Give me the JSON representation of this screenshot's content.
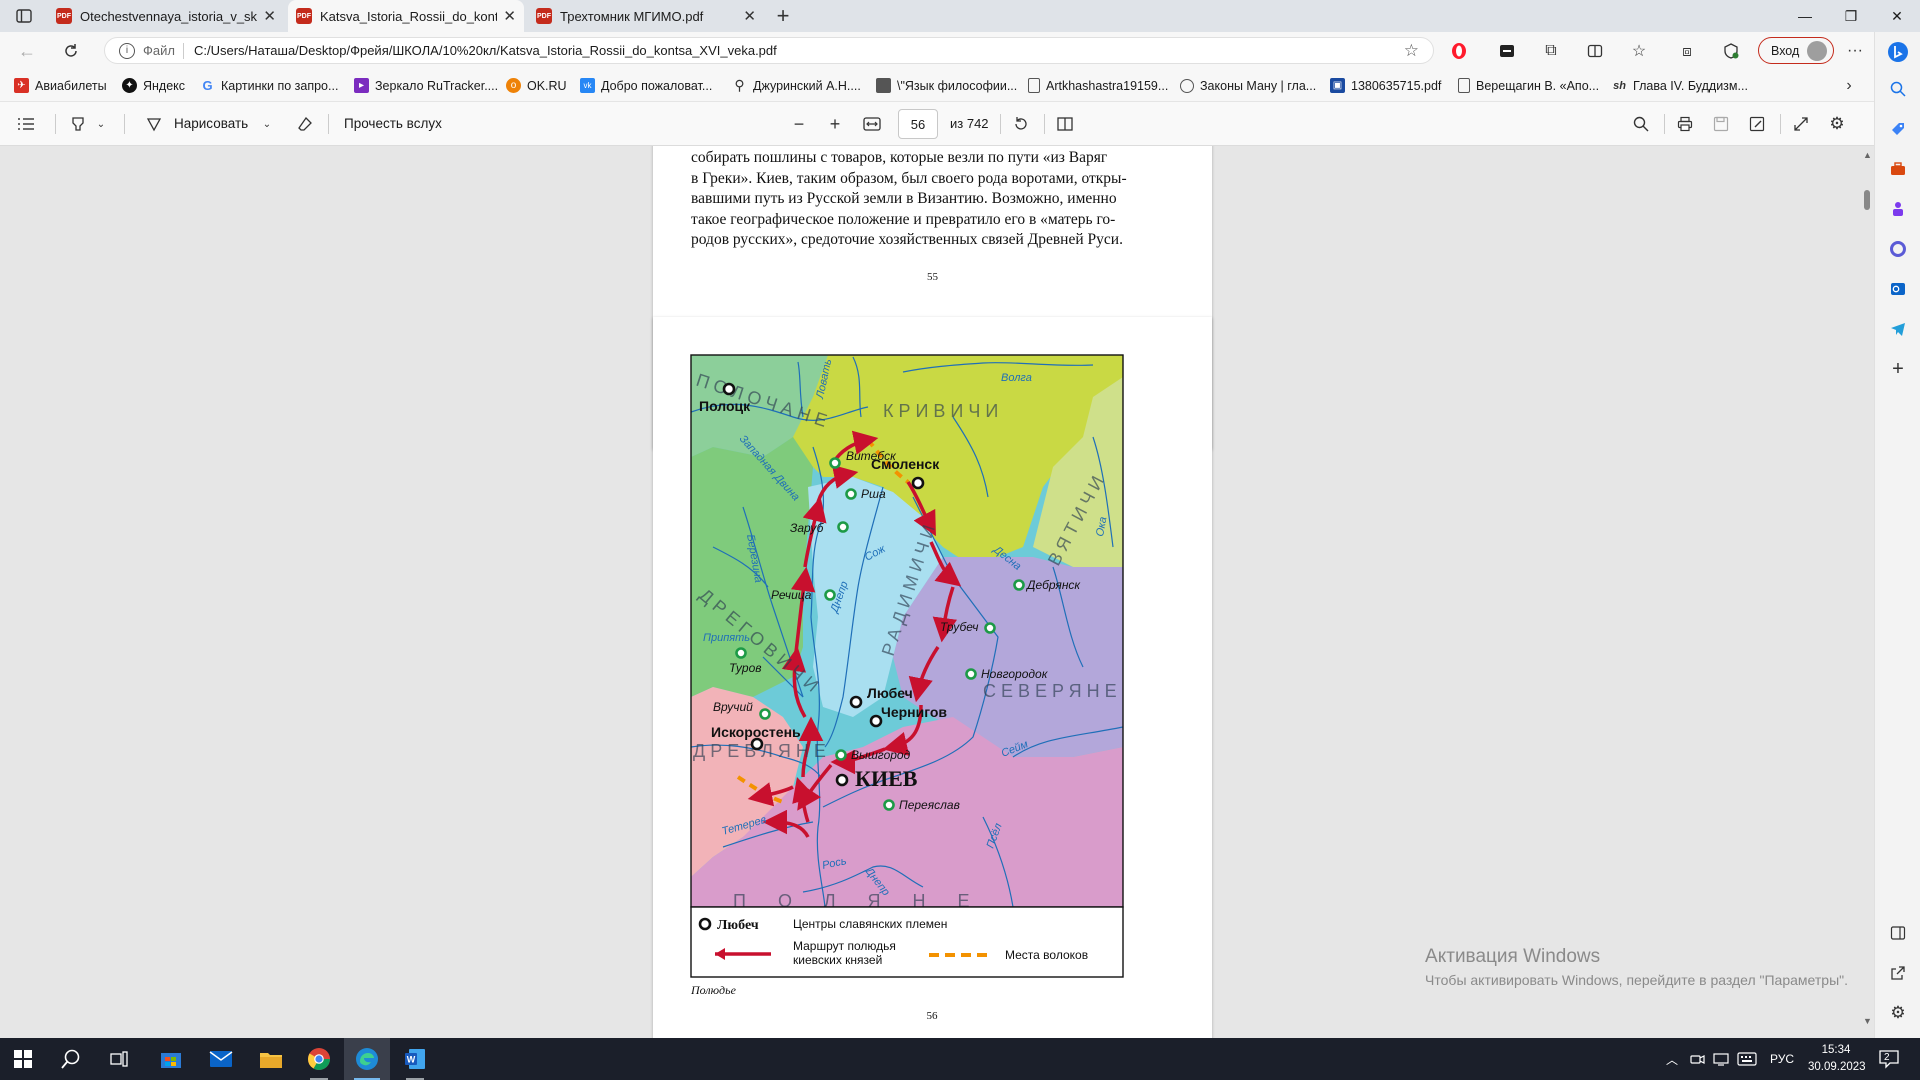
{
  "tabs": [
    {
      "title": "Otechestvennaya_istoria_v_skhem",
      "active": false
    },
    {
      "title": "Katsva_Istoria_Rossii_do_kontsa_",
      "active": true
    },
    {
      "title": "Трехтомник МГИМО.pdf",
      "active": false
    }
  ],
  "address": {
    "prefix": "Файл",
    "url": "C:/Users/Наташа/Desktop/Фрейя/ШКОЛА/10%20кл/Katsva_Istoria_Rossii_do_kontsa_XVI_veka.pdf"
  },
  "profile_button": "Вход",
  "bookmarks": [
    {
      "label": "Авиабилеты",
      "icon": "airplane-icon",
      "color": "#d93025"
    },
    {
      "label": "Яндекс",
      "icon": "yandex-icon",
      "color": "#111111"
    },
    {
      "label": "Картинки по запро...",
      "icon": "google-icon",
      "color": "#4285f4"
    },
    {
      "label": "Зеркало RuTracker....",
      "icon": "rutracker-icon",
      "color": "#7b2cbf"
    },
    {
      "label": "OK.RU",
      "icon": "ok-icon",
      "color": "#ee8208"
    },
    {
      "label": "Добро пожаловат...",
      "icon": "vk-icon",
      "color": "#2787f5"
    },
    {
      "label": "Джуринский А.Н....",
      "icon": "lamp-icon",
      "color": "#333333"
    },
    {
      "label": "\\\"Язык философии...",
      "icon": "square-icon",
      "color": "#555555"
    },
    {
      "label": "Artkhashastra19159...",
      "icon": "document-icon",
      "color": "#555555"
    },
    {
      "label": "Законы Ману | гла...",
      "icon": "globe-icon",
      "color": "#555555"
    },
    {
      "label": "1380635715.pdf",
      "icon": "image-icon",
      "color": "#1a4aa0"
    },
    {
      "label": "Верещагин В. «Апо...",
      "icon": "document-icon",
      "color": "#555555"
    },
    {
      "label": "Глава IV. Буддизм...",
      "icon": "sh-icon",
      "color": "#333333"
    }
  ],
  "pdf_toolbar": {
    "draw_label": "Нарисовать",
    "read_aloud_label": "Прочесть вслух",
    "page_value": "56",
    "page_total": "из 742"
  },
  "page55": {
    "lines": [
      "собирать пошлины с товаров, которые везли по пути «из Варяг",
      "в Греки». Киев, таким образом, был своего рода воротами, откры-",
      "вавшими путь из Русской земли в Византию. Возможно, именно",
      "такое географическое положение и превратило его в «матерь го-",
      "родов русских», средоточие хозяйственных связей Древней Руси."
    ],
    "number": "55"
  },
  "map": {
    "tribes": [
      "ПОЛОЧАНЕ",
      "КРИВИЧИ",
      "ВЯТИЧИ",
      "ДРЕГОВИЧИ",
      "РАДИМИЧИ",
      "СЕВЕРЯНЕ",
      "ДРЕВЛЯНЕ",
      "ПОЛЯНЕ"
    ],
    "centers": [
      "Полоцк",
      "Смоленск",
      "Любеч",
      "Чернигов",
      "Искоростень",
      "КИЕВ"
    ],
    "towns": [
      "Витебск",
      "Рша",
      "Заруб",
      "Речица",
      "Дебрянск",
      "Трубеч",
      "Новгородок",
      "Туров",
      "Вручий",
      "Вышгород",
      "Переяслав"
    ],
    "rivers": [
      "Ловать",
      "Волга",
      "Западная Двина",
      "Березина",
      "Сож",
      "Днепр",
      "Десна",
      "Ока",
      "Припять",
      "Сейм",
      "Тетерев",
      "Рось",
      "Псёл",
      "Днепр"
    ],
    "legend": {
      "center_sample": "Любеч",
      "center_desc": "Центры славянских племен",
      "route_desc_1": "Маршрут полюдья",
      "route_desc_2": "киевских князей",
      "portage_desc": "Места волоков"
    },
    "caption": "Полюдье",
    "page_number": "56",
    "colors": {
      "route": "#c8102e",
      "portage": "#f39200"
    }
  },
  "activation": {
    "title": "Активация Windows",
    "subtitle": "Чтобы активировать Windows, перейдите в раздел \"Параметры\"."
  },
  "taskbar": {
    "lang": "РУС",
    "time": "15:34",
    "date": "30.09.2023",
    "notifications": "2"
  }
}
